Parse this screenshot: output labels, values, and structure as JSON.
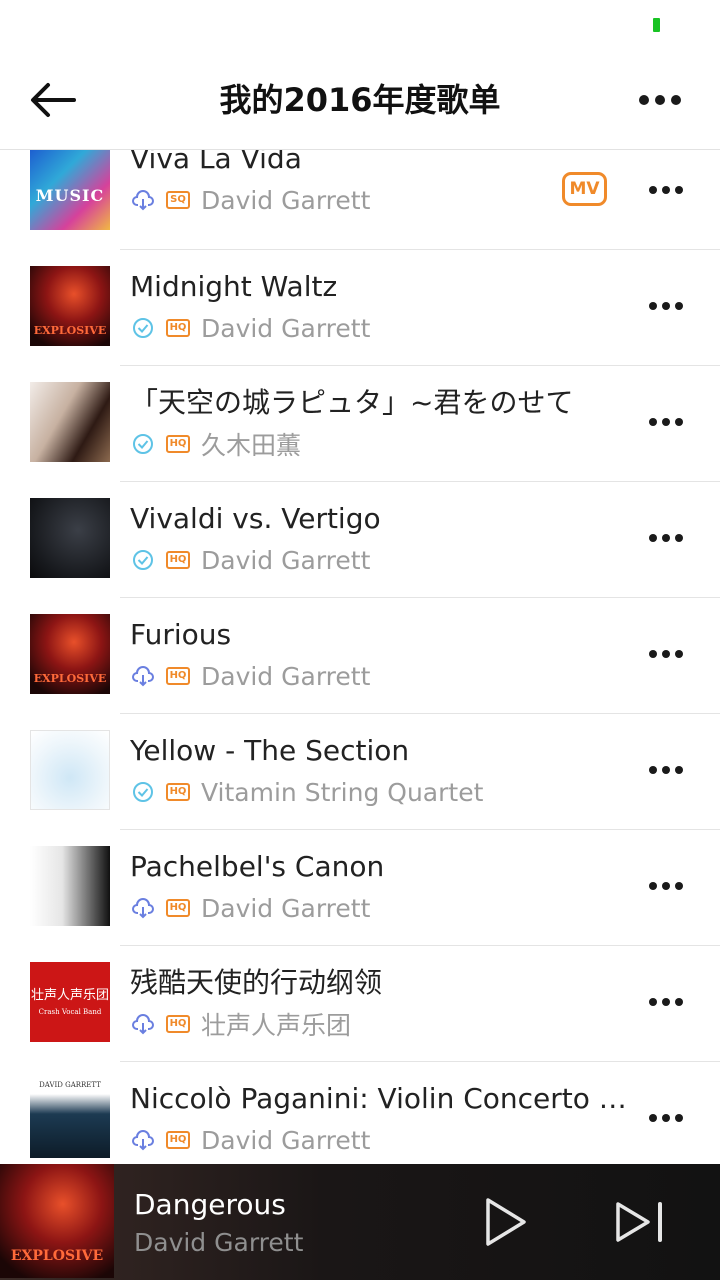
{
  "header": {
    "title": "我的2016年度歌单"
  },
  "songs": [
    {
      "title": "Viva La Vida",
      "artist": "David Garrett",
      "status": "cloud-icon",
      "quality": "SQ",
      "mv": "MV",
      "cover": "music"
    },
    {
      "title": "Midnight Waltz",
      "artist": "David Garrett",
      "status": "downloaded-check-icon",
      "quality": "HQ",
      "cover": "explosive"
    },
    {
      "title": "「天空の城ラピュタ」~君をのせて",
      "artist": "久木田薫",
      "status": "downloaded-check-icon",
      "quality": "HQ",
      "cover": "kaoru"
    },
    {
      "title": "Vivaldi vs. Vertigo",
      "artist": "David Garrett",
      "status": "downloaded-check-icon",
      "quality": "HQ",
      "cover": "vertigo"
    },
    {
      "title": "Furious",
      "artist": "David Garrett",
      "status": "cloud-icon",
      "quality": "HQ",
      "cover": "explosive"
    },
    {
      "title": "Yellow - The Section",
      "artist": "Vitamin String Quartet",
      "status": "downloaded-check-icon",
      "quality": "HQ",
      "cover": "yellow"
    },
    {
      "title": "Pachelbel's Canon",
      "artist": "David Garrett",
      "status": "cloud-icon",
      "quality": "HQ",
      "cover": "canon"
    },
    {
      "title": "残酷天使的行动纲领",
      "artist": "壮声人声乐团",
      "status": "cloud-icon",
      "quality": "HQ",
      "cover": "crash"
    },
    {
      "title": "Niccolò Paganini: Violin Concerto No...",
      "artist": "David Garrett",
      "status": "cloud-icon",
      "quality": "HQ",
      "cover": "paganini"
    }
  ],
  "cover_art_text": {
    "music": "MUSIC",
    "explosive": "EXPLOSIVE",
    "crash_line1": "壮声人声乐团",
    "crash_line2": "Crash Vocal Band",
    "paganini": "DAVID GARRETT"
  },
  "player": {
    "title": "Dangerous",
    "artist": "David Garrett"
  },
  "colors": {
    "accent_orange": "#f08a2a",
    "battery_green": "#19c324",
    "cloud_blue": "#6a7fe0",
    "check_teal": "#5ec3e6"
  }
}
